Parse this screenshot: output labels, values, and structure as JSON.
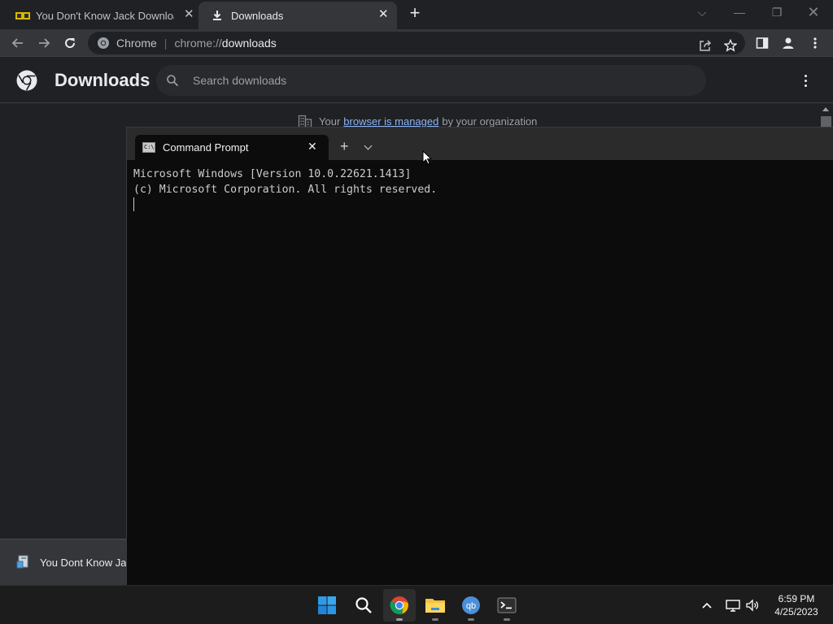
{
  "browser": {
    "tabs": [
      {
        "title": "You Don't Know Jack Download |",
        "favicon": "yellow-game-favicon",
        "active": false
      },
      {
        "title": "Downloads",
        "favicon": "download-icon",
        "active": true
      }
    ],
    "omnibox": {
      "site_name": "Chrome",
      "url_scheme": "chrome://",
      "url_host": "downloads"
    }
  },
  "downloads_page": {
    "title": "Downloads",
    "search_placeholder": "Search downloads",
    "managed_notice": {
      "prefix": "Your",
      "link": "browser is managed",
      "suffix": "by your organization"
    }
  },
  "download_shelf": {
    "item_name": "You Dont Know Ja..."
  },
  "terminal": {
    "tab_title": "Command Prompt",
    "lines": [
      "Microsoft Windows [Version 10.0.22621.1413]",
      "(c) Microsoft Corporation. All rights reserved."
    ]
  },
  "taskbar": {
    "apps": [
      "start",
      "search",
      "chrome",
      "file-explorer",
      "qbittorrent",
      "terminal"
    ],
    "qbittorrent_label": "qb",
    "time": "6:59 PM",
    "date": "4/25/2023"
  },
  "colors": {
    "chrome_dark": "#202124",
    "toolbar": "#35363a",
    "link": "#8ab4f8",
    "terminal_bg": "#0c0c0c"
  }
}
